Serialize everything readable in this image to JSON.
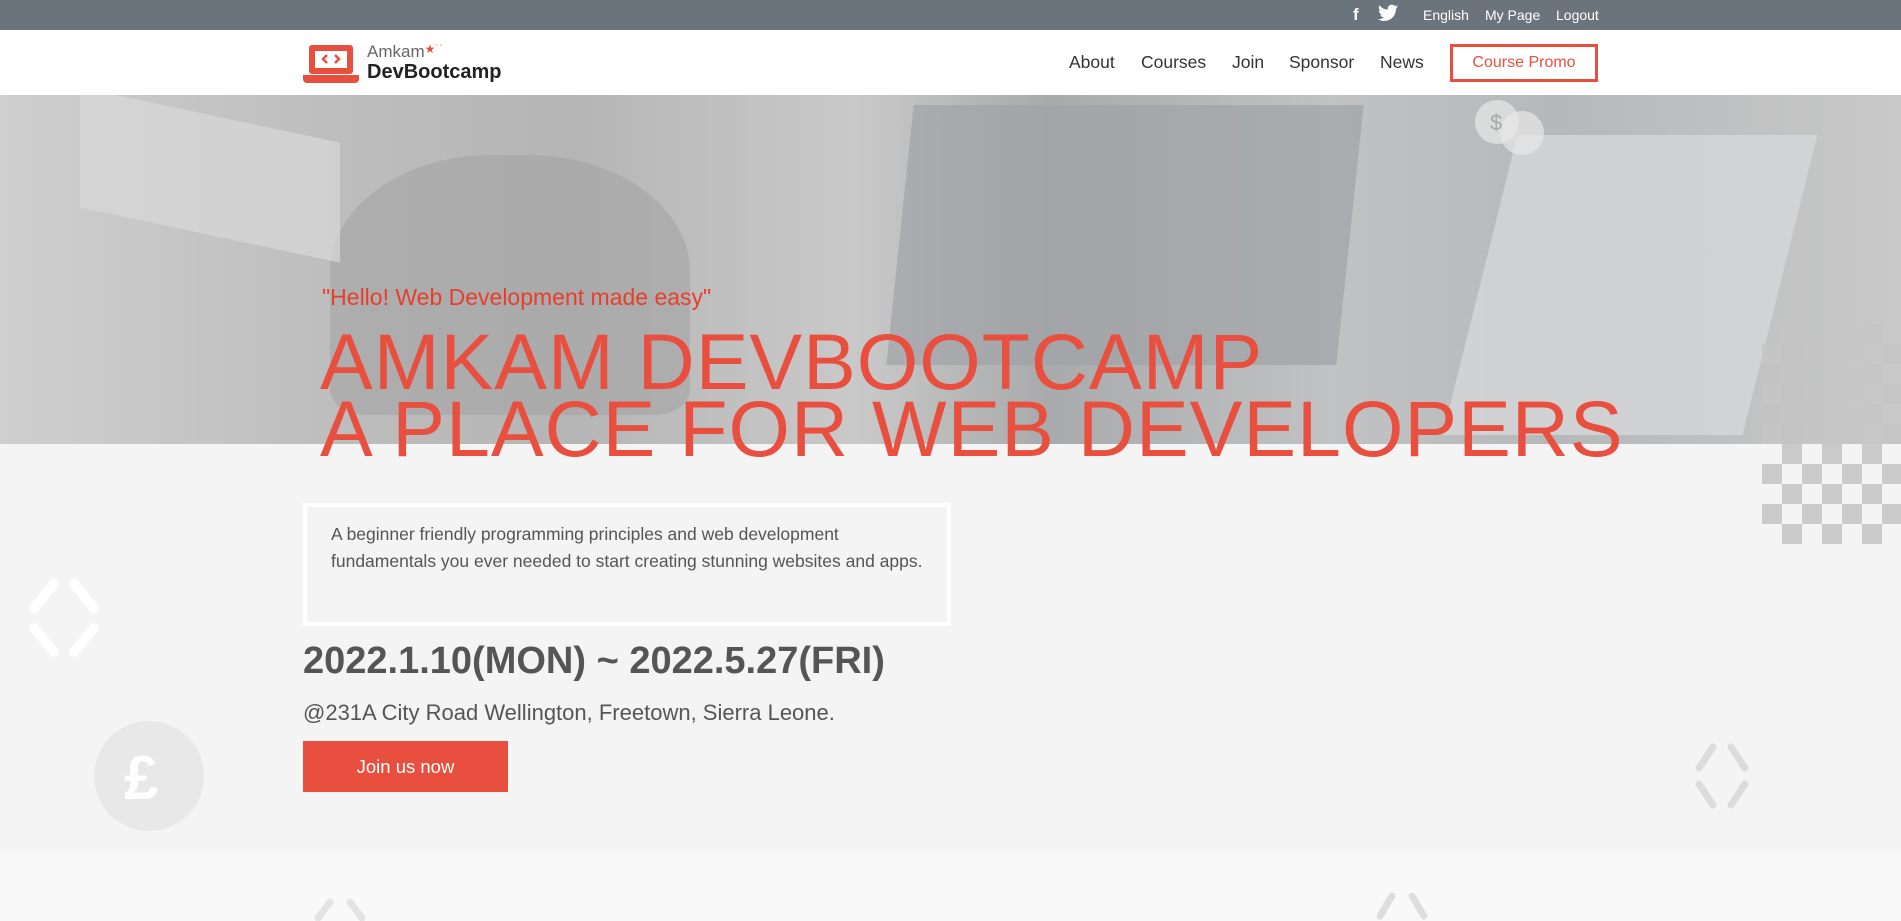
{
  "topbar": {
    "social": [
      "facebook-icon",
      "twitter-icon"
    ],
    "links": [
      "English",
      "My Page",
      "Logout"
    ]
  },
  "logo": {
    "top": "Amkam",
    "main": "DevBootcamp"
  },
  "nav": {
    "items": [
      "About",
      "Courses",
      "Join",
      "Sponsor",
      "News"
    ],
    "promo": "Course Promo"
  },
  "hero": {
    "quote": "\"Hello! Web Development made easy\"",
    "title_line1": "AMKAM DEVBOOTCAMP",
    "title_line2": "A PLACE FOR WEB DEVELOPERS",
    "description": "A beginner friendly programming principles and web development fundamentals you ever needed to start creating stunning websites and apps.",
    "dates": "2022.1.10(MON) ~ 2022.5.27(FRI)",
    "address": "@231A City Road Wellington, Freetown, Sierra Leone.",
    "cta": "Join us now"
  },
  "colors": {
    "accent": "#e94f3f",
    "topbar": "#6b737c",
    "text": "#555555"
  }
}
